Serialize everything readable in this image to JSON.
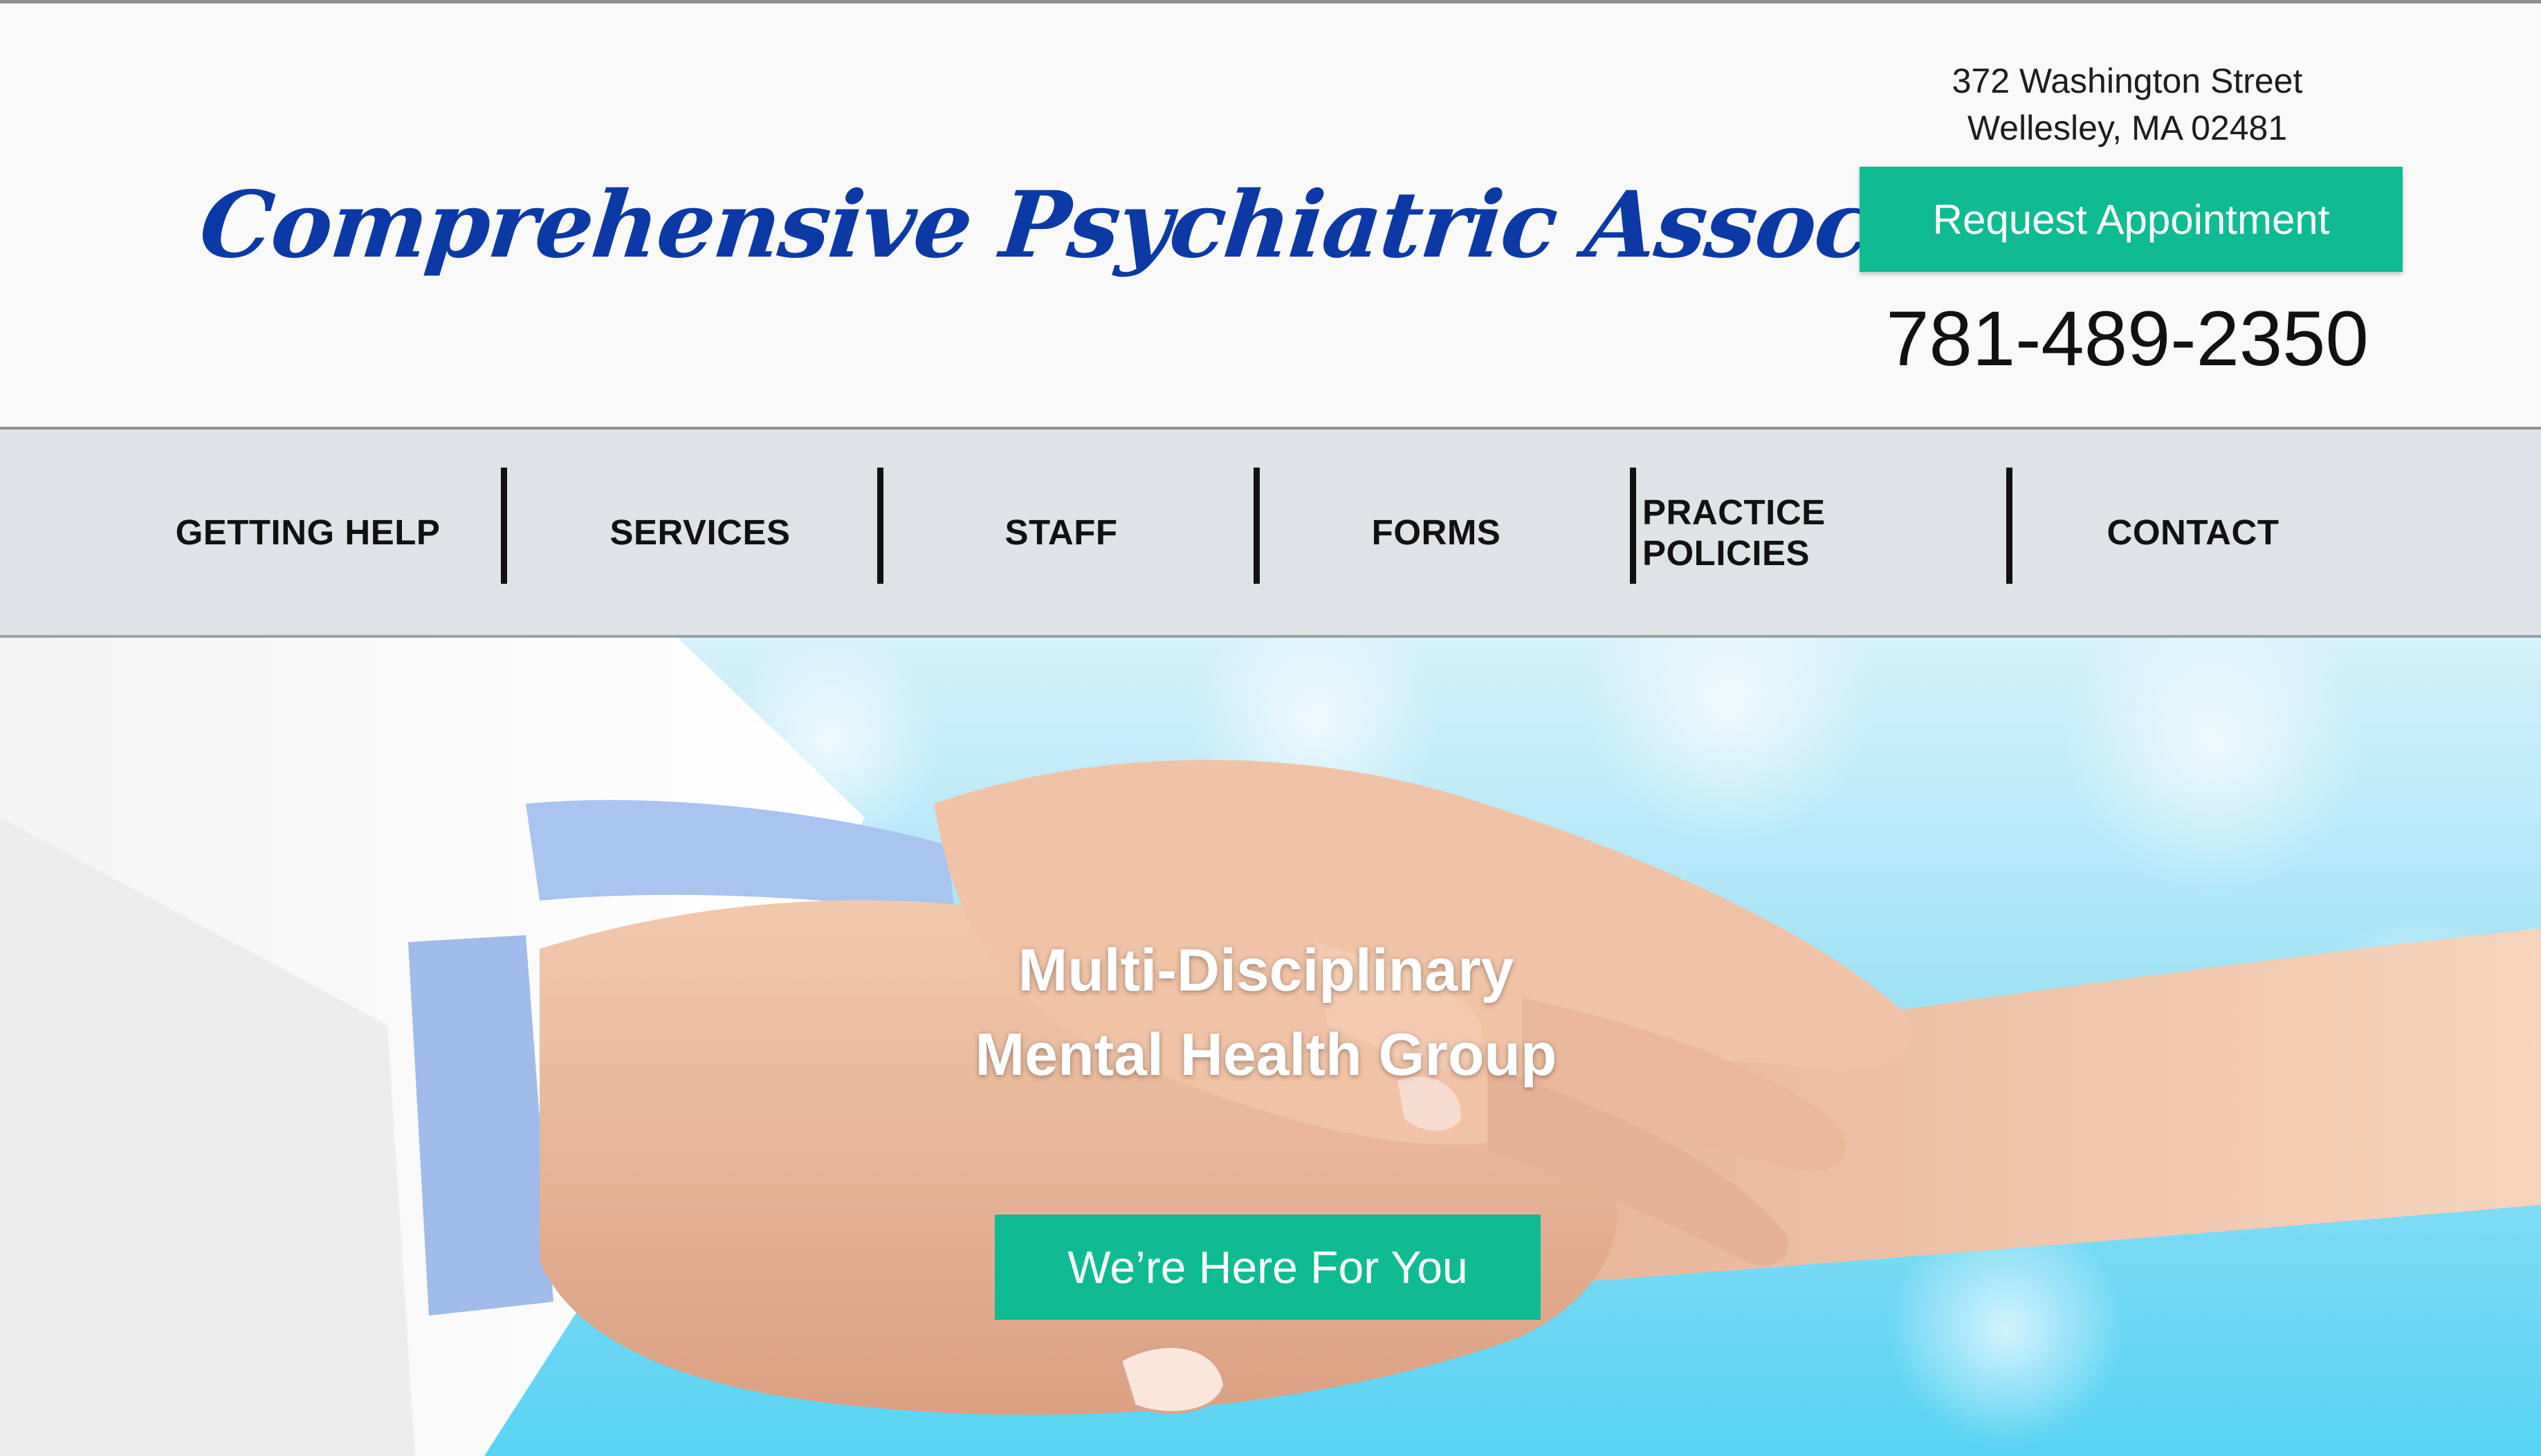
{
  "header": {
    "logo_text": "Comprehensive Psychiatric Associates",
    "address_line1": "372 Washington Street",
    "address_line2": "Wellesley, MA 02481",
    "request_button_label": "Request Appointment",
    "phone": "781-489-2350"
  },
  "nav": {
    "items": [
      {
        "label": "GETTING HELP"
      },
      {
        "label": "SERVICES"
      },
      {
        "label": "STAFF"
      },
      {
        "label": "FORMS"
      },
      {
        "label": "PRACTICE POLICIES"
      },
      {
        "label": "CONTACT"
      }
    ]
  },
  "hero": {
    "title_line1": "Multi-Disciplinary",
    "title_line2": "Mental Health Group",
    "cta_label": "We’re Here For You",
    "image_alt": "hands-holding-image"
  },
  "colors": {
    "accent": "#0fbb92",
    "logo_blue": "#0b3aa6",
    "nav_background": "#dee3e6",
    "header_background": "#f9f9f9"
  }
}
